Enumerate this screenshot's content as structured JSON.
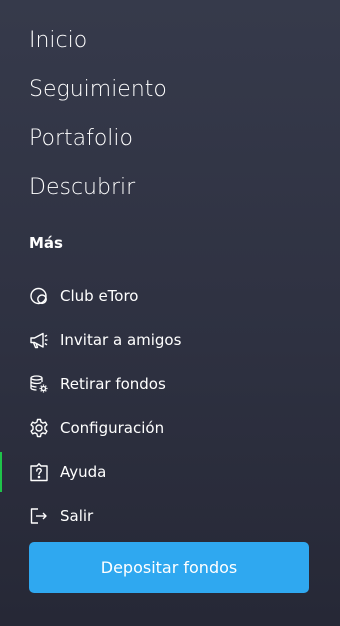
{
  "main_nav": {
    "items": [
      {
        "label": "Inicio"
      },
      {
        "label": "Seguimiento"
      },
      {
        "label": "Portafolio"
      },
      {
        "label": "Descubrir"
      }
    ]
  },
  "more_section": {
    "title": "Más",
    "items": [
      {
        "label": "Club eToro",
        "icon": "club-icon"
      },
      {
        "label": "Invitar a amigos",
        "icon": "megaphone-icon"
      },
      {
        "label": "Retirar fondos",
        "icon": "coins-gear-icon"
      },
      {
        "label": "Configuración",
        "icon": "gear-icon"
      },
      {
        "label": "Ayuda",
        "icon": "help-icon",
        "active": true
      },
      {
        "label": "Salir",
        "icon": "logout-icon"
      }
    ]
  },
  "deposit_button": {
    "label": "Depositar fondos"
  },
  "colors": {
    "background_top": "#363a4b",
    "background_bottom": "#262836",
    "accent_button": "#2fa8f0",
    "active_indicator": "#1fc34a",
    "text": "#ffffff"
  }
}
